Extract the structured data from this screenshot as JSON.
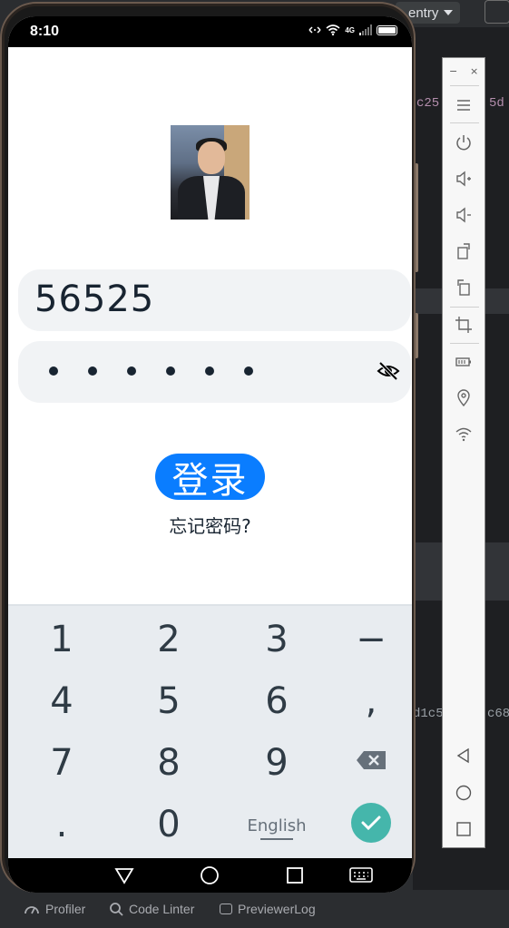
{
  "ide": {
    "run_config": "entry",
    "code_fragments": [
      "c25",
      "5d",
      "d1c5",
      "c68"
    ],
    "bottom_tabs": [
      "Profiler",
      "Code Linter",
      "PreviewerLog"
    ]
  },
  "status_bar": {
    "time": "8:10",
    "network": "4G"
  },
  "login": {
    "username_value": "56525",
    "password_masked_count": 6,
    "login_label": "登录",
    "forgot_label": "忘记密码?"
  },
  "keyboard": {
    "keys": [
      "1",
      "2",
      "3",
      "−",
      "4",
      "5",
      "6",
      ",",
      "7",
      "8",
      "9",
      ".",
      "0",
      "English"
    ]
  },
  "colors": {
    "accent": "#0a7dff",
    "confirm": "#45b6ab",
    "field_bg": "#f1f3f5",
    "keyboard_bg": "#e8ecf0"
  }
}
